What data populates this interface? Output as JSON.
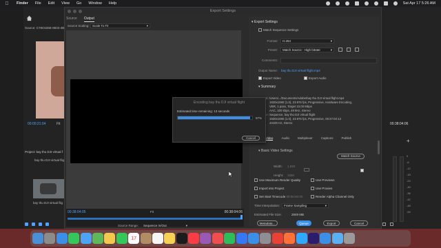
{
  "menubar": {
    "app_name": "Finder",
    "items": [
      "File",
      "Edit",
      "View",
      "Go",
      "Window",
      "Help"
    ],
    "clock": "Sat Apr 17  5:26 AM"
  },
  "left_panel": {
    "source_label": "Source: C78C626E-8834-4B",
    "source_time": "00:00:21:04",
    "source_fit": "Fit",
    "project_label": "Project: bay thu DJI virtual f",
    "project_file": "bay thu DJI virtual flight",
    "project_item_name": "bay thu DJI virtual flig"
  },
  "right_panel": {
    "program_time": "00:38:04:06",
    "meter_ticks": [
      "0",
      "-6",
      "-12",
      "-18",
      "-24",
      "-30",
      "-36",
      "-42",
      "-48",
      "-54"
    ]
  },
  "export": {
    "window_title": "Export Settings",
    "tabs": [
      {
        "label": "Source",
        "active": false
      },
      {
        "label": "Output",
        "active": true
      }
    ],
    "source_scaling_label": "Source Scaling:",
    "source_scaling_value": "Scale To Fit",
    "timeline": {
      "time_in": "00:38:04:05",
      "fit": "Fit",
      "time_out": "00:38:04:06",
      "source_range_label": "Source Range:",
      "source_range_value": "Sequence In/Out"
    },
    "encoding": {
      "title": "Encoding bay thu DJI virtual flight",
      "remaining": "Estimated time remaining: 13 seconds",
      "percent_text": "97%",
      "progress": 0.97,
      "cancel": "Cancel"
    },
    "settings": {
      "header": "Export Settings",
      "match_sequence": "Match Sequence Settings",
      "format_label": "Format:",
      "format_value": "H.264",
      "preset_label": "Preset:",
      "preset_value": "Match Source - High bitrate",
      "comments_label": "Comments:",
      "output_name_label": "Output Name:",
      "output_name_value": "bay thu DJI virtual flight.mp4",
      "export_video": "Export Video",
      "export_audio": "Export Audio",
      "summary_header": "Summary",
      "summary_output_key": "Output:",
      "summary_output_lines": [
        "/Users/.../Documents/Adobe/bay thu DJI virtual flight.mp4",
        "1920x1080 (1.0), 23.976 fps, Progressive, Hardware Encoding,",
        "VBR, 1 pass, Target 10.00 Mbps",
        "AAC, 320 kbps, 48 kHz, Stereo"
      ],
      "summary_source_key": "Source:",
      "summary_source_lines": [
        "Sequence, bay thu DJI virtual flight",
        "1920x1080 (1.0), 23.976 fps, Progressive, 00:37:03:13",
        "44100 Hz, Stereo"
      ],
      "video_tabs": [
        "Video",
        "Audio",
        "Multiplexer",
        "Captions",
        "Publish"
      ],
      "basic_video": "Basic Video Settings",
      "match_source": "Match Source",
      "width_label": "Width:",
      "width_value": "1,920",
      "height_label": "Height:",
      "height_value": "1080"
    },
    "options": {
      "max_render": "Use Maximum Render Quality",
      "use_previews": "Use Previews",
      "import_project": "Import into Project",
      "use_proxies": "Use Proxies",
      "set_start_tc": "Set Start Timecode",
      "start_tc_value": "00:00:00:00",
      "render_alpha": "Render Alpha Channel Only",
      "time_interp_label": "Time Interpolation:",
      "time_interp_value": "Frame Sampling",
      "file_size_label": "Estimated File Size:",
      "file_size_value": "2849 MB"
    },
    "buttons": {
      "metadata": "Metadata...",
      "queue": "Queue",
      "export": "Export",
      "cancel": "Cancel"
    }
  },
  "dock": {
    "icons": [
      "finder-icon",
      "launchpad-icon",
      "safari-icon",
      "messages-icon",
      "mail-icon",
      "maps-icon",
      "photos-icon",
      "facetime-icon",
      "calendar-icon",
      "contacts-icon",
      "reminders-icon",
      "notes-icon",
      "tv-icon",
      "music-icon",
      "podcasts-icon",
      "news-icon",
      "numbers-icon",
      "keynote-icon",
      "app-store-icon",
      "settings-icon",
      "chrome-icon",
      "firefox-icon",
      "photoshop-icon",
      "premiere-icon",
      "downloads-icon",
      "folder-icon",
      "trash-icon"
    ],
    "calendar_day": "17",
    "colors": [
      "#4a90d9",
      "#8c8c8c",
      "#3b8fe6",
      "#35c759",
      "#4fa3f7",
      "#5fb85a",
      "#f2c94c",
      "#34c759",
      "#ffffff",
      "#b08d63",
      "#f5f5f5",
      "#f7d154",
      "#1c1c1e",
      "#fc3c44",
      "#9b59b6",
      "#f04e4e",
      "#2dbd5a",
      "#3478f6",
      "#3b8fe6",
      "#8e8e93",
      "#e94235",
      "#ff7139",
      "#31a8ff",
      "#2a1d6b",
      "#3b8fe6",
      "#5ab0f0",
      "#9a9a9a"
    ]
  }
}
